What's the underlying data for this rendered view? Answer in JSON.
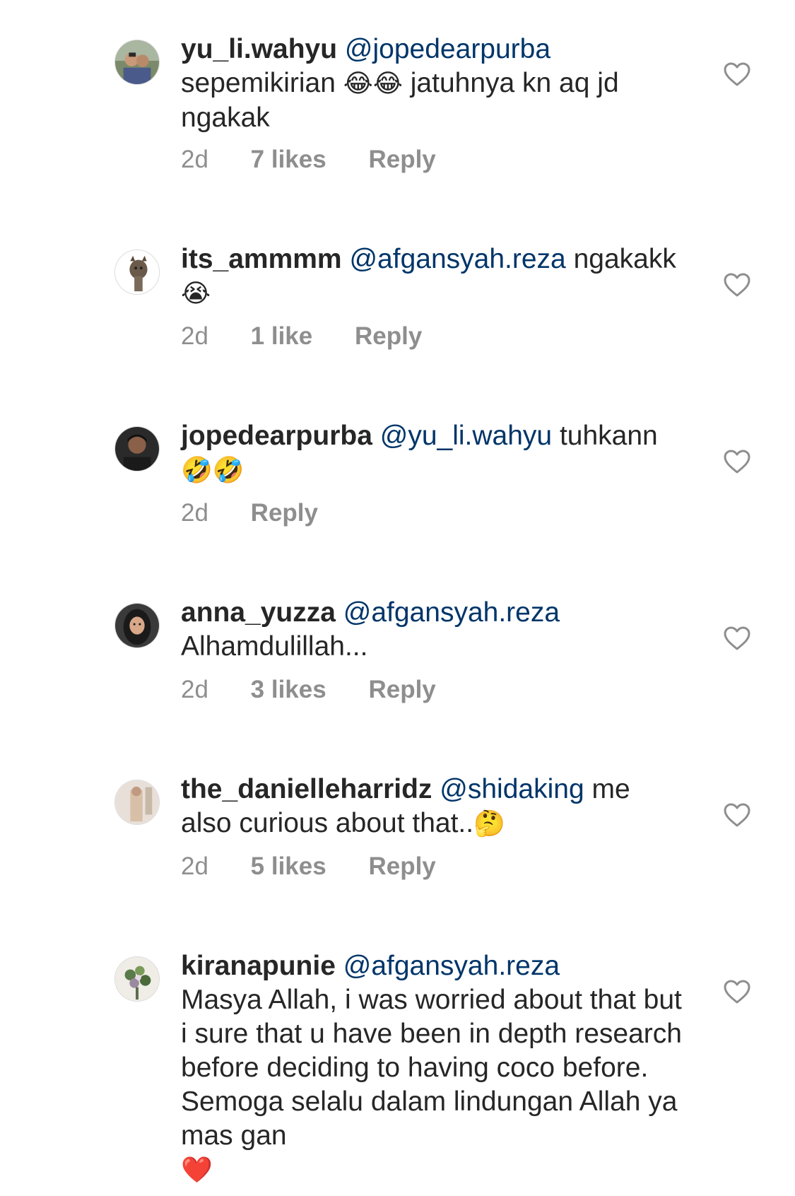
{
  "colors": {
    "text": "#262626",
    "mention": "#003569",
    "meta": "#8e8e8e",
    "heart_outline": "#8e8e8e"
  },
  "comments": [
    {
      "username": "yu_li.wahyu",
      "mention": "@jopedearpurba",
      "text_before": "sepemikirian",
      "emoji": "😂😂",
      "text_after": "jatuhnya kn aq jd ngakak",
      "time": "2d",
      "likes": "7 likes",
      "reply": "Reply",
      "avatar_icon": "profile-photo-icon",
      "heart_icon": "heart-outline-icon"
    },
    {
      "username": "its_ammmm",
      "mention": "@afgansyah.reza",
      "text_before": "ngakakk",
      "emoji": "😭",
      "text_after": "",
      "time": "2d",
      "likes": "1 like",
      "reply": "Reply",
      "avatar_icon": "cat-photo-icon",
      "heart_icon": "heart-outline-icon"
    },
    {
      "username": "jopedearpurba",
      "mention": "@yu_li.wahyu",
      "text_before": "tuhkann",
      "emoji": "🤣🤣",
      "text_after": "",
      "time": "2d",
      "likes": "",
      "reply": "Reply",
      "avatar_icon": "profile-photo-icon",
      "heart_icon": "heart-outline-icon"
    },
    {
      "username": "anna_yuzza",
      "mention": "@afgansyah.reza",
      "text_before": "Alhamdulillah...",
      "emoji": "",
      "text_after": "",
      "time": "2d",
      "likes": "3 likes",
      "reply": "Reply",
      "avatar_icon": "profile-photo-icon",
      "heart_icon": "heart-outline-icon"
    },
    {
      "username": "the_danielleharridz",
      "mention": "@shidaking",
      "text_before": "me also curious about that..",
      "emoji": "🤔",
      "text_after": "",
      "time": "2d",
      "likes": "5 likes",
      "reply": "Reply",
      "avatar_icon": "profile-photo-icon",
      "heart_icon": "heart-outline-icon"
    },
    {
      "username": "kiranapunie",
      "mention": "@afgansyah.reza",
      "text_before": "Masya Allah, i was worried about that but i sure that u have been in depth research before deciding to having coco before. Semoga selalu dalam lindungan Allah ya mas gan",
      "emoji": "❤️",
      "text_after": "",
      "time": "",
      "likes": "",
      "reply": "",
      "avatar_icon": "flowers-photo-icon",
      "heart_icon": "heart-outline-icon"
    }
  ]
}
